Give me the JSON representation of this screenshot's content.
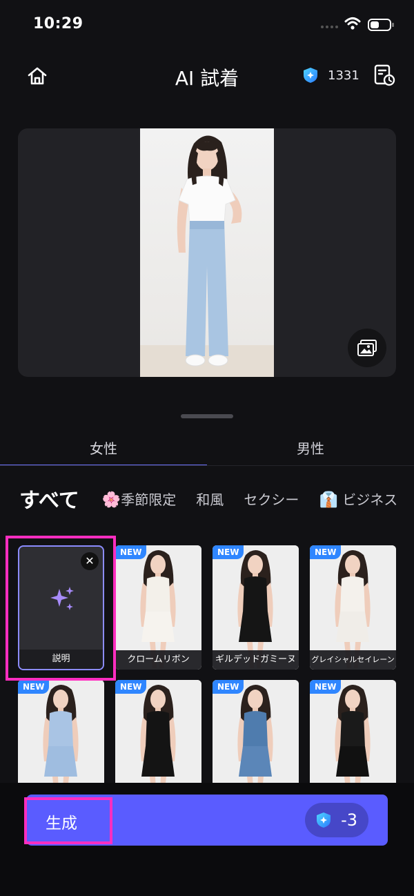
{
  "status_bar": {
    "time": "10:29"
  },
  "header": {
    "title": "AI 試着",
    "credits": "1331"
  },
  "gender_tabs": [
    {
      "label": "女性",
      "active": true
    },
    {
      "label": "男性",
      "active": false
    }
  ],
  "categories": [
    {
      "label": "すべて",
      "emoji": "",
      "active": true
    },
    {
      "label": "季節限定",
      "emoji": "🌸"
    },
    {
      "label": "和風",
      "emoji": ""
    },
    {
      "label": "セクシー",
      "emoji": ""
    },
    {
      "label": "ビジネス",
      "emoji": "👔"
    }
  ],
  "explain_card": {
    "label": "説明",
    "close": "✕"
  },
  "outfits": [
    {
      "label": "クロームリボン",
      "new_badge": "NEW",
      "top": "#f3f0ea",
      "bottom": "#f6f3ee"
    },
    {
      "label": "ギルデッドガミーヌ",
      "new_badge": "NEW",
      "top": "#151515",
      "bottom": "#151515"
    },
    {
      "label": "グレイシャルセイレーン",
      "new_badge": "NEW",
      "top": "#f4f1ec",
      "bottom": "#f0ede8"
    },
    {
      "label": "",
      "new_badge": "NEW",
      "top": "#a9c4e4",
      "bottom": "#9fbde0"
    },
    {
      "label": "",
      "new_badge": "NEW",
      "top": "#141414",
      "bottom": "#141414"
    },
    {
      "label": "",
      "new_badge": "NEW",
      "top": "#4f7cae",
      "bottom": "#5b86b8"
    },
    {
      "label": "",
      "new_badge": "NEW",
      "top": "#1a1a1a",
      "bottom": "#111111"
    }
  ],
  "generate": {
    "label": "生成",
    "cost": "-3"
  },
  "colors": {
    "accent": "#5a5cff",
    "highlight": "#ff2ec0",
    "badge": "#2f86ff"
  }
}
